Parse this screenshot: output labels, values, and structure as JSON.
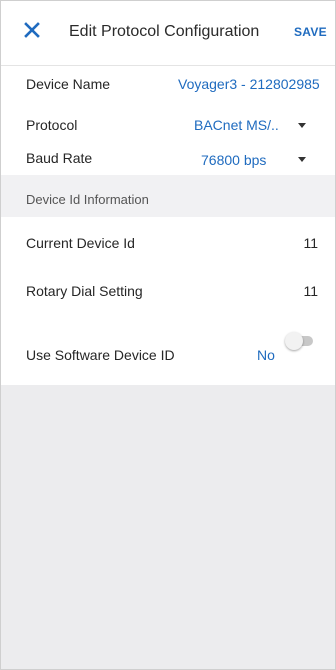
{
  "header": {
    "close_icon": "close-icon",
    "title": "Edit Protocol Configuration",
    "save_label": "SAVE"
  },
  "form": {
    "device_name": {
      "label": "Device Name",
      "value": "Voyager3 - 212802985"
    },
    "protocol": {
      "label": "Protocol",
      "value": "BACnet MS/..",
      "dropdown_icon": "caret-down-icon"
    },
    "baud_rate": {
      "label": "Baud Rate",
      "value": "76800 bps",
      "dropdown_icon": "caret-down-icon"
    }
  },
  "device_id_section": {
    "title": "Device Id Information",
    "current_device_id": {
      "label": "Current Device Id",
      "value": "11"
    },
    "rotary_dial_setting": {
      "label": "Rotary Dial Setting",
      "value": "11"
    },
    "use_software_device_id": {
      "label": "Use Software Device ID",
      "value": "No",
      "enabled": false
    }
  },
  "colors": {
    "accent": "#1f6bbf",
    "background": "#ececee",
    "surface": "#ffffff"
  }
}
